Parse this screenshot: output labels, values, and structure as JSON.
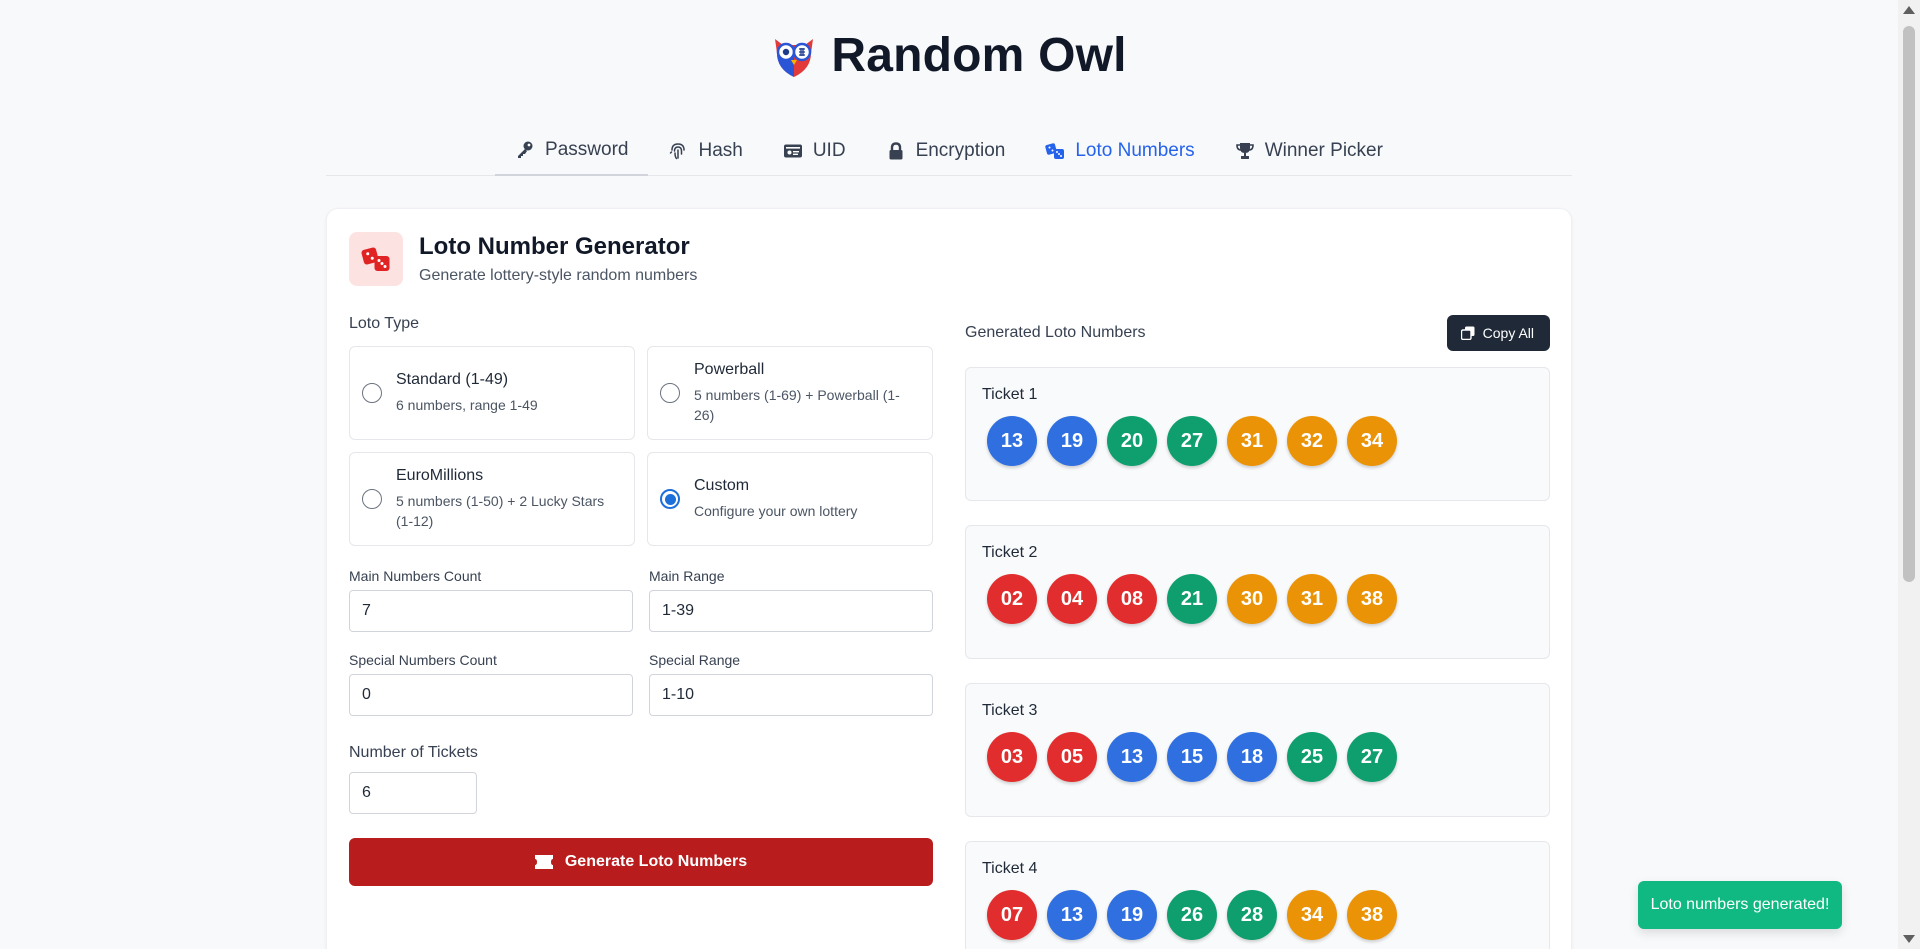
{
  "app": {
    "title": "Random Owl"
  },
  "nav": {
    "tabs": [
      {
        "label": "Password",
        "icon": "key-icon"
      },
      {
        "label": "Hash",
        "icon": "fingerprint-icon"
      },
      {
        "label": "UID",
        "icon": "id-card-icon"
      },
      {
        "label": "Encryption",
        "icon": "lock-icon"
      },
      {
        "label": "Loto Numbers",
        "icon": "dice-icon",
        "selected": true
      },
      {
        "label": "Winner Picker",
        "icon": "trophy-icon"
      }
    ]
  },
  "generator": {
    "title": "Loto Number Generator",
    "subtitle": "Generate lottery-style random numbers",
    "type_label": "Loto Type",
    "types": [
      {
        "name": "Standard (1-49)",
        "desc": "6 numbers, range 1-49",
        "selected": false
      },
      {
        "name": "Powerball",
        "desc": "5 numbers (1-69) + Powerball (1-26)",
        "selected": false
      },
      {
        "name": "EuroMillions",
        "desc": "5 numbers (1-50) + 2 Lucky Stars (1-12)",
        "selected": false
      },
      {
        "name": "Custom",
        "desc": "Configure your own lottery",
        "selected": true
      }
    ],
    "fields": {
      "main_count_label": "Main Numbers Count",
      "main_count": "7",
      "main_range_label": "Main Range",
      "main_range": "1-39",
      "special_count_label": "Special Numbers Count",
      "special_count": "0",
      "special_range_label": "Special Range",
      "special_range": "1-10",
      "tickets_label": "Number of Tickets",
      "tickets": "6"
    },
    "generate_label": "Generate Loto Numbers"
  },
  "results": {
    "label": "Generated Loto Numbers",
    "copy_label": "Copy All",
    "tickets": [
      {
        "title": "Ticket 1",
        "numbers": [
          "13",
          "19",
          "20",
          "27",
          "31",
          "32",
          "34"
        ],
        "colors": [
          "blue",
          "blue",
          "green",
          "green",
          "orange",
          "orange",
          "orange"
        ]
      },
      {
        "title": "Ticket 2",
        "numbers": [
          "02",
          "04",
          "08",
          "21",
          "30",
          "31",
          "38"
        ],
        "colors": [
          "red",
          "red",
          "red",
          "green",
          "orange",
          "orange",
          "orange"
        ]
      },
      {
        "title": "Ticket 3",
        "numbers": [
          "03",
          "05",
          "13",
          "15",
          "18",
          "25",
          "27"
        ],
        "colors": [
          "red",
          "red",
          "blue",
          "blue",
          "blue",
          "green",
          "green"
        ]
      },
      {
        "title": "Ticket 4",
        "numbers": [
          "07",
          "13",
          "19",
          "26",
          "28",
          "34",
          "38"
        ],
        "colors": [
          "red",
          "blue",
          "blue",
          "green",
          "green",
          "orange",
          "orange"
        ]
      }
    ]
  },
  "toast": {
    "message": "Loto numbers generated!"
  },
  "colors": {
    "accent": "#2563eb",
    "primary_button": "#b91c1c",
    "toast": "#10b981",
    "blue": "#2f6fe0",
    "green": "#0f9f6e",
    "orange": "#eb9307",
    "red": "#e12d2d"
  }
}
